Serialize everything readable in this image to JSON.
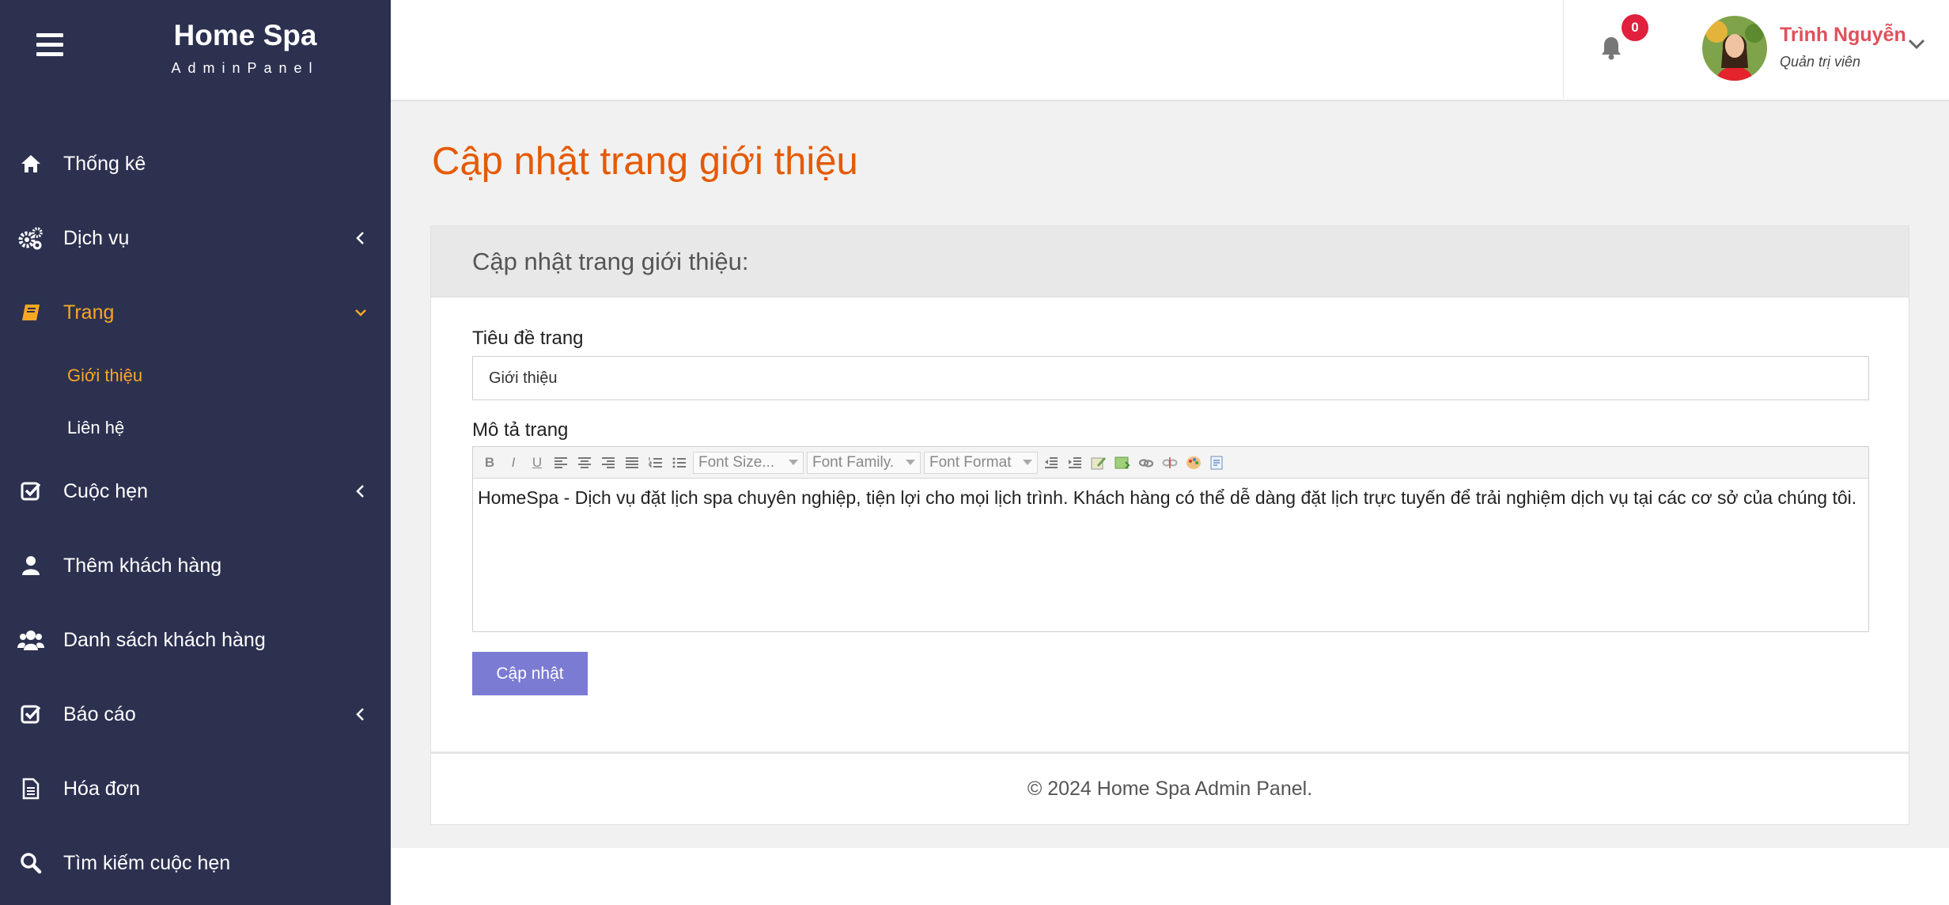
{
  "brand": {
    "title": "Home Spa",
    "subtitle": "AdminPanel"
  },
  "sidebar": {
    "items": [
      {
        "label": "Thống kê",
        "icon": "home-icon"
      },
      {
        "label": "Dịch vụ",
        "icon": "gears-icon"
      },
      {
        "label": "Trang",
        "icon": "book-icon"
      },
      {
        "label": "Cuộc hẹn",
        "icon": "check-square-icon"
      },
      {
        "label": "Thêm khách hàng",
        "icon": "user-icon"
      },
      {
        "label": "Danh sách khách hàng",
        "icon": "users-icon"
      },
      {
        "label": "Báo cáo",
        "icon": "check-square-icon"
      },
      {
        "label": "Hóa đơn",
        "icon": "file-icon"
      },
      {
        "label": "Tìm kiếm cuộc hẹn",
        "icon": "search-icon"
      }
    ],
    "sub": [
      {
        "label": "Giới thiệu"
      },
      {
        "label": "Liên hệ"
      }
    ]
  },
  "header": {
    "notification_count": "0",
    "user_name": "Trình Nguyễn",
    "user_role": "Quản trị viên"
  },
  "page": {
    "title": "Cập nhật trang giới thiệu",
    "card_title": "Cập nhật trang giới thiệu:",
    "title_label": "Tiêu đề trang",
    "title_value": "Giới thiệu",
    "desc_label": "Mô tả trang",
    "toolbar": {
      "font_size": "Font Size...",
      "font_family": "Font Family.",
      "font_format": "Font Format"
    },
    "desc_value": "HomeSpa - Dịch vụ đặt lịch spa chuyên nghiệp, tiện lợi cho mọi lịch trình. Khách hàng có thể dễ dàng đặt lịch trực tuyến để trải nghiệm dịch vụ tại các cơ sở của chúng tôi.",
    "button": "Cập nhật",
    "footer": "© 2024 Home Spa Admin Panel."
  },
  "colors": {
    "sidebar": "#2d3150",
    "active": "#f7a823",
    "title": "#e55a00",
    "button": "#7b7bd4",
    "badge": "#e0203c"
  }
}
